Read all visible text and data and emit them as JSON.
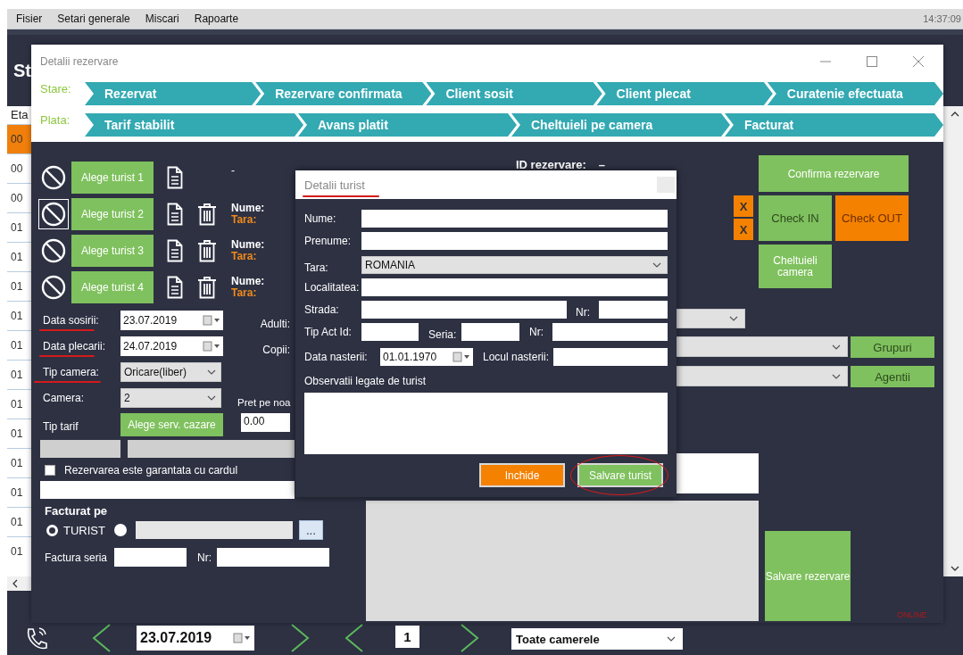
{
  "menu": [
    {
      "label": "Fisier"
    },
    {
      "label": "Setari generale"
    },
    {
      "label": "Miscari"
    },
    {
      "label": "Rapoarte"
    }
  ],
  "clock": "14:37:09",
  "main": {
    "title": "St",
    "table": {
      "column_1": "Eta",
      "rows": [
        {
          "column_1": "00",
          "highlighted": true
        },
        {
          "column_1": "00",
          "highlighted": false
        },
        {
          "column_1": "00",
          "highlighted": false
        },
        {
          "column_1": "01",
          "highlighted": false
        },
        {
          "column_1": "01",
          "highlighted": false
        },
        {
          "column_1": "01",
          "highlighted": false
        },
        {
          "column_1": "01",
          "highlighted": false
        },
        {
          "column_1": "01",
          "highlighted": false
        },
        {
          "column_1": "01",
          "highlighted": false
        },
        {
          "column_1": "01",
          "highlighted": false
        },
        {
          "column_1": "01",
          "highlighted": false
        },
        {
          "column_1": "01",
          "highlighted": false
        },
        {
          "column_1": "01",
          "highlighted": false
        },
        {
          "column_1": "01",
          "highlighted": false
        },
        {
          "column_1": "01",
          "highlighted": false
        }
      ]
    }
  },
  "bottom_bar": {
    "date": "23.07.2019",
    "page": "1",
    "room_filter": "Toate camerele"
  },
  "reservation": {
    "title": "Detalii rezervare",
    "status_rows": [
      {
        "label": "Stare:",
        "steps": [
          "Rezervat",
          "Rezervare confirmata",
          "Client sosit",
          "Client plecat",
          "Curatenie efectuata"
        ]
      },
      {
        "label": "Plata:",
        "steps": [
          "Tarif stabilit",
          "Avans platit",
          "Cheltuieli pe camera",
          "Facturat"
        ]
      }
    ],
    "tourists": [
      {
        "kind": "empty",
        "button": "Alege turist 1",
        "focused": false,
        "info": "-"
      },
      {
        "kind": "filled",
        "button": "Alege turist 2",
        "focused": true,
        "name_label": "Nume:",
        "country_label": "Tara:"
      },
      {
        "kind": "filled",
        "button": "Alege turist 3",
        "focused": false,
        "name_label": "Nume:",
        "country_label": "Tara:"
      },
      {
        "kind": "filled",
        "button": "Alege turist 4",
        "focused": false,
        "name_label": "Nume:",
        "country_label": "Tara:"
      }
    ],
    "id_label": "ID rezervare:",
    "id_value": "–",
    "arrival": {
      "label": "Data sosirii:",
      "value": "23.07.2019",
      "extra_label": "Adulti:"
    },
    "departure": {
      "label": "Data plecarii:",
      "value": "24.07.2019",
      "extra_label": "Copii:"
    },
    "room_type": {
      "label": "Tip camera:",
      "value": "Oricare(liber)"
    },
    "room": {
      "label": "Camera:",
      "value": "2",
      "extra_label": "Pret pe noa"
    },
    "rate": {
      "label": "Tip tarif",
      "button": "Alege serv. cazare",
      "price": "0.00"
    },
    "card_guarantee": {
      "label": "Rezervarea este garantata cu cardul",
      "checked": false
    },
    "invoice": {
      "title": "Facturat pe",
      "options": [
        {
          "label": "TURIST",
          "selected": true
        },
        {
          "selected": false
        }
      ],
      "browse_button": "...",
      "series_label": "Factura seria",
      "number_label": "Nr:"
    },
    "actions": {
      "confirm": "Confirma rezervare",
      "clear_marks": [
        "X",
        "X"
      ],
      "check_in": "Check IN",
      "check_out": "Check OUT",
      "room_expenses": "Cheltuieli camera",
      "groups": "Grupuri",
      "agencies": "Agentii",
      "save": "Salvare rezervare"
    },
    "connection_status": "ONLINE"
  },
  "tourist_dialog": {
    "title": "Detalii turist",
    "form_lines": [
      {
        "fields": [
          {
            "label": "Nume:",
            "kind": "text"
          }
        ]
      },
      {
        "fields": [
          {
            "label": "Prenume:",
            "kind": "text"
          }
        ]
      },
      {
        "fields": [
          {
            "label": "Tara:",
            "kind": "select",
            "value": "ROMANIA"
          }
        ]
      },
      {
        "fields": [
          {
            "label": "Localitatea:",
            "kind": "text"
          }
        ]
      },
      {
        "fields": [
          {
            "label": "Strada:",
            "kind": "text"
          },
          {
            "label": "Nr:",
            "kind": "text"
          }
        ]
      },
      {
        "fields": [
          {
            "label": "Tip Act Id:",
            "kind": "text"
          },
          {
            "label": "Seria:",
            "kind": "text"
          },
          {
            "label": "Nr:",
            "kind": "text"
          }
        ]
      },
      {
        "fields": [
          {
            "label": "Data nasterii:",
            "kind": "date",
            "value": "01.01.1970"
          },
          {
            "label": "Locul nasterii:",
            "kind": "text"
          }
        ]
      },
      {
        "fields": [
          {
            "label": "Observatii legate de turist",
            "kind": "textarea"
          }
        ]
      }
    ],
    "buttons": [
      {
        "kind": "close",
        "label": "Inchide"
      },
      {
        "kind": "save",
        "label": "Salvare turist"
      }
    ]
  }
}
